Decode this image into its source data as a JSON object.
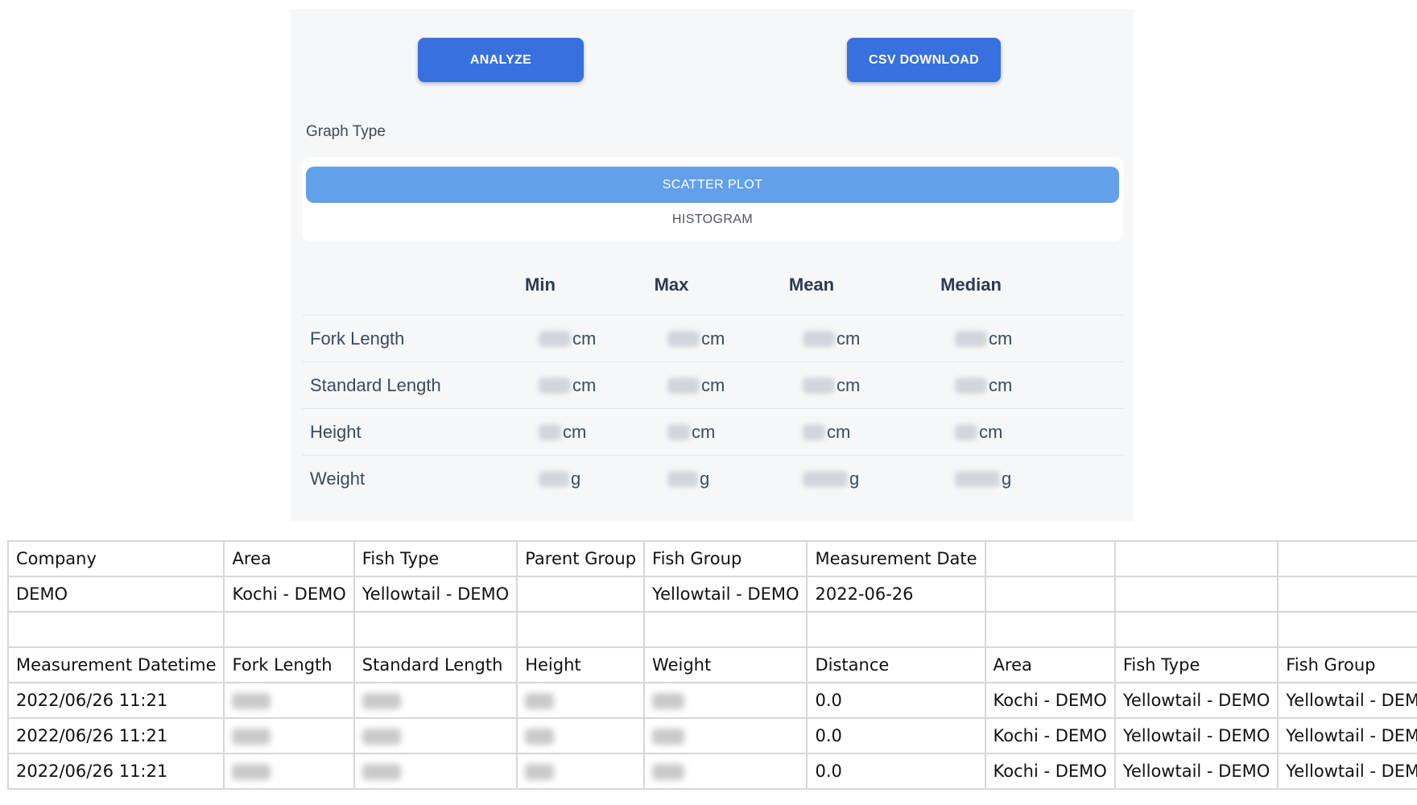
{
  "buttons": {
    "analyze": "ANALYZE",
    "csv": "CSV DOWNLOAD"
  },
  "graph_type": {
    "label": "Graph Type",
    "options": [
      "SCATTER PLOT",
      "HISTOGRAM"
    ],
    "selected": "SCATTER PLOT"
  },
  "stats": {
    "headers": [
      "Min",
      "Max",
      "Mean",
      "Median"
    ],
    "rows": [
      {
        "label": "Fork Length",
        "unit": "cm"
      },
      {
        "label": "Standard Length",
        "unit": "cm"
      },
      {
        "label": "Height",
        "unit": "cm"
      },
      {
        "label": "Weight",
        "unit": "g"
      }
    ]
  },
  "table": {
    "header1": [
      "Company",
      "Area",
      "Fish Type",
      "Parent Group",
      "Fish Group",
      "Measurement Date",
      "",
      "",
      ""
    ],
    "row1": [
      "DEMO",
      "Kochi - DEMO",
      "Yellowtail - DEMO",
      "",
      "Yellowtail - DEMO",
      "2022-06-26",
      "",
      "",
      ""
    ],
    "header2": [
      "Measurement Datetime",
      "Fork Length",
      "Standard Length",
      "Height",
      "Weight",
      "Distance",
      "Area",
      "Fish Type",
      "Fish Group"
    ],
    "rows": [
      [
        "2022/06/26 11:21",
        "",
        "",
        "",
        "",
        "0.0",
        "Kochi - DEMO",
        "Yellowtail - DEMO",
        "Yellowtail - DEMO"
      ],
      [
        "2022/06/26 11:21",
        "",
        "",
        "",
        "",
        "0.0",
        "Kochi - DEMO",
        "Yellowtail - DEMO",
        "Yellowtail - DEMO"
      ],
      [
        "2022/06/26 11:21",
        "",
        "",
        "",
        "",
        "0.0",
        "Kochi - DEMO",
        "Yellowtail - DEMO",
        "Yellowtail - DEMO"
      ]
    ]
  }
}
